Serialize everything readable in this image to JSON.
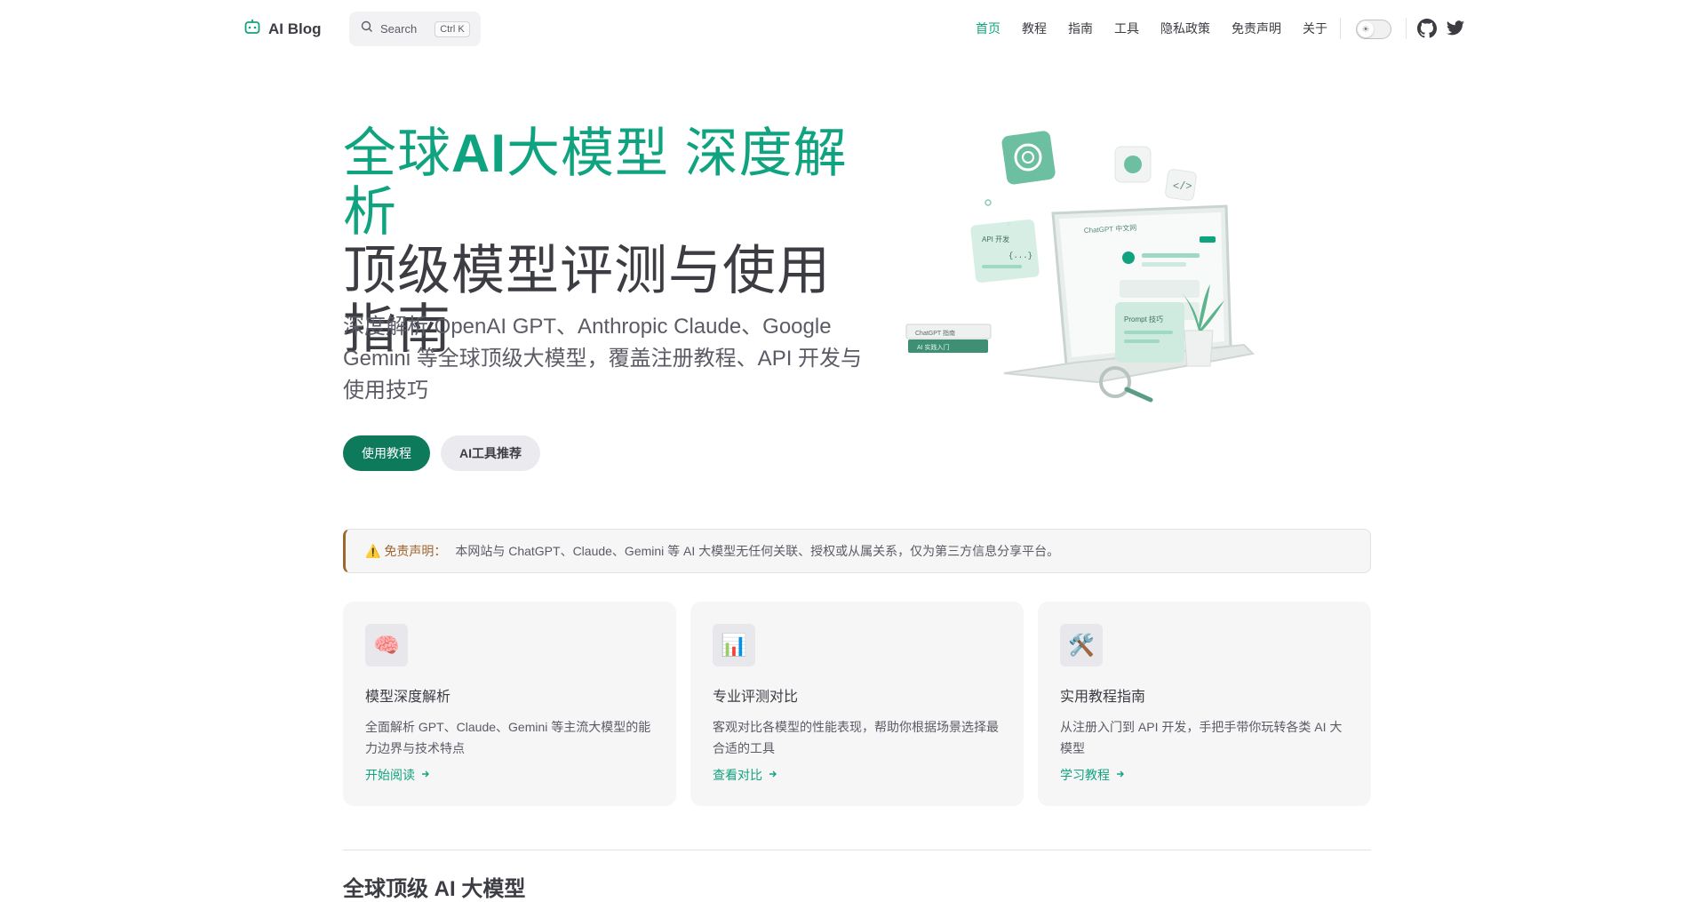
{
  "nav": {
    "brand": "AI Blog",
    "search_label": "Search",
    "search_kbd": "Ctrl K",
    "items": [
      {
        "label": "首页",
        "active": true
      },
      {
        "label": "教程"
      },
      {
        "label": "指南"
      },
      {
        "label": "工具"
      },
      {
        "label": "隐私政策"
      },
      {
        "label": "免责声明"
      },
      {
        "label": "关于"
      }
    ],
    "accent_color": "#10a37f"
  },
  "hero": {
    "title_part1": "全球",
    "title_ai": "AI",
    "title_part2": "大模型 深度解析",
    "subtitle": "顶级模型评测与使用指南",
    "description": "深度解析 OpenAI GPT、Anthropic Claude、Google Gemini 等全球顶级大模型，覆盖注册教程、API 开发与使用技巧",
    "primary_button": "使用教程",
    "secondary_button": "AI工具推荐",
    "illustration": {
      "screen_title": "ChatGPT 中文网",
      "card_api": "API 开发",
      "card_api_code": "{...}",
      "card_prompt": "Prompt 技巧",
      "book_top": "ChatGPT 指南",
      "book_bottom": "AI 实践入门"
    }
  },
  "notice": {
    "label": "⚠️ 免责声明：",
    "text": "本网站与 ChatGPT、Claude、Gemini 等 AI 大模型无任何关联、授权或从属关系，仅为第三方信息分享平台。"
  },
  "features": [
    {
      "icon": "🧠",
      "icon_name": "brain-icon",
      "title": "模型深度解析",
      "desc": "全面解析 GPT、Claude、Gemini 等主流大模型的能力边界与技术特点",
      "link": "开始阅读"
    },
    {
      "icon": "📊",
      "icon_name": "chart-icon",
      "title": "专业评测对比",
      "desc": "客观对比各模型的性能表现，帮助你根据场景选择最合适的工具",
      "link": "查看对比"
    },
    {
      "icon": "🛠️",
      "icon_name": "tools-icon",
      "title": "实用教程指南",
      "desc": "从注册入门到 API 开发，手把手带你玩转各类 AI 大模型",
      "link": "学习教程"
    }
  ],
  "section_title": "全球顶级 AI 大模型"
}
